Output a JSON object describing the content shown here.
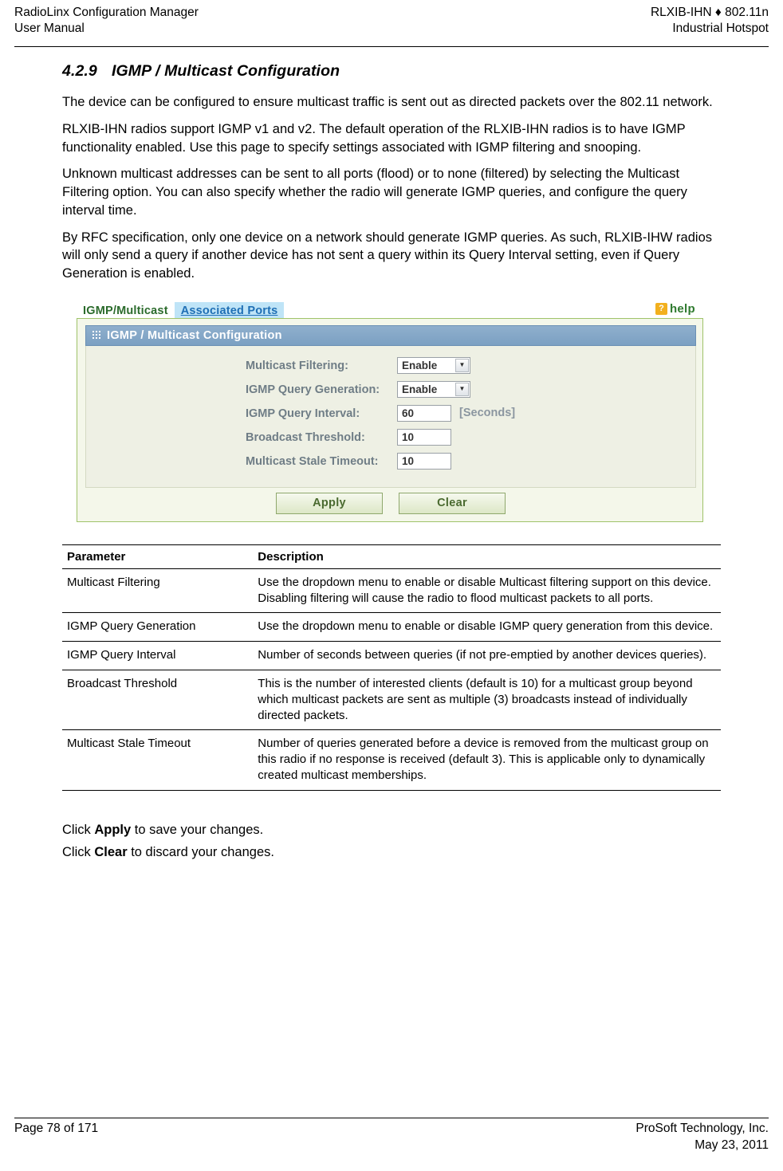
{
  "header": {
    "left_line1": "RadioLinx Configuration Manager",
    "left_line2": "User Manual",
    "right_line1": "RLXIB-IHN ♦ 802.11n",
    "right_line2": "Industrial Hotspot"
  },
  "section": {
    "number": "4.2.9",
    "title": "IGMP / Multicast Configuration",
    "paragraphs": [
      "The device can be configured to ensure multicast traffic is sent out as directed packets over the 802.11 network.",
      "RLXIB-IHN radios support IGMP v1 and v2. The default operation of the RLXIB-IHN radios is to have IGMP functionality enabled. Use this page to specify settings associated with IGMP filtering and snooping.",
      "Unknown multicast addresses can be sent to all ports (flood) or to none (filtered) by selecting the Multicast Filtering option. You can also specify whether the radio will generate IGMP queries, and configure the query interval time.",
      "By RFC specification, only one device on a network should generate IGMP queries. As such, RLXIB-IHW radios will only send a query if another device has not sent a query within its Query Interval setting, even if Query Generation is enabled."
    ]
  },
  "screenshot": {
    "tabs": [
      {
        "label": "IGMP/Multicast",
        "active": true
      },
      {
        "label": "Associated Ports",
        "active": false
      }
    ],
    "help": {
      "badge": "?",
      "label": "help"
    },
    "panel_title": "IGMP / Multicast Configuration",
    "fields": [
      {
        "label": "Multicast Filtering:",
        "type": "select",
        "value": "Enable",
        "unit": ""
      },
      {
        "label": "IGMP Query Generation:",
        "type": "select",
        "value": "Enable",
        "unit": ""
      },
      {
        "label": "IGMP Query Interval:",
        "type": "text",
        "value": "60",
        "unit": "[Seconds]"
      },
      {
        "label": "Broadcast Threshold:",
        "type": "text",
        "value": "10",
        "unit": ""
      },
      {
        "label": "Multicast Stale Timeout:",
        "type": "text",
        "value": "10",
        "unit": ""
      }
    ],
    "buttons": [
      {
        "label": "Apply"
      },
      {
        "label": "Clear"
      }
    ],
    "colors": {
      "panel_border": "#9fc36a",
      "titlebar": "#7ba0c2",
      "help_badge": "#f2b01e",
      "tab_active": "#2b6b2c",
      "tab_inactive_bg": "#bfe4f7"
    }
  },
  "table": {
    "headers": [
      "Parameter",
      "Description"
    ],
    "rows": [
      {
        "parameter": "Multicast Filtering",
        "description": "Use the dropdown menu to enable or disable Multicast filtering support on this device. Disabling filtering will cause the radio to flood multicast packets to all ports."
      },
      {
        "parameter": "IGMP Query Generation",
        "description": "Use the dropdown menu to enable or disable IGMP query generation from this device."
      },
      {
        "parameter": "IGMP Query Interval",
        "description": "Number of seconds between queries (if not pre-emptied by another devices queries)."
      },
      {
        "parameter": "Broadcast Threshold",
        "description": "This is the number of interested clients (default is 10) for a multicast group beyond which multicast packets are sent as multiple (3) broadcasts instead of individually directed packets."
      },
      {
        "parameter": "Multicast Stale Timeout",
        "description": "Number of queries generated before a device is removed from the multicast group on this radio if no response is received (default 3). This is applicable only to dynamically created multicast memberships."
      }
    ]
  },
  "closing": {
    "line1_pre": "Click ",
    "line1_bold": "Apply",
    "line1_post": " to save your changes.",
    "line2_pre": "Click ",
    "line2_bold": "Clear",
    "line2_post": " to discard your changes."
  },
  "footer": {
    "left": "Page 78 of 171",
    "right_line1": "ProSoft Technology, Inc.",
    "right_line2": "May 23, 2011"
  }
}
